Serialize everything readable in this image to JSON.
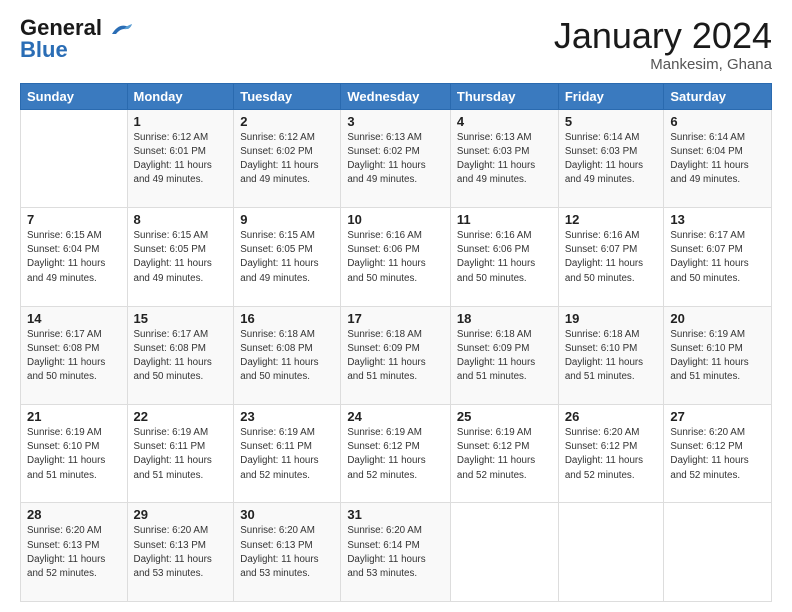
{
  "header": {
    "logo_line1": "General",
    "logo_line2": "Blue",
    "month": "January 2024",
    "location": "Mankesim, Ghana"
  },
  "days_of_week": [
    "Sunday",
    "Monday",
    "Tuesday",
    "Wednesday",
    "Thursday",
    "Friday",
    "Saturday"
  ],
  "weeks": [
    [
      {
        "num": "",
        "info": ""
      },
      {
        "num": "1",
        "info": "Sunrise: 6:12 AM\nSunset: 6:01 PM\nDaylight: 11 hours\nand 49 minutes."
      },
      {
        "num": "2",
        "info": "Sunrise: 6:12 AM\nSunset: 6:02 PM\nDaylight: 11 hours\nand 49 minutes."
      },
      {
        "num": "3",
        "info": "Sunrise: 6:13 AM\nSunset: 6:02 PM\nDaylight: 11 hours\nand 49 minutes."
      },
      {
        "num": "4",
        "info": "Sunrise: 6:13 AM\nSunset: 6:03 PM\nDaylight: 11 hours\nand 49 minutes."
      },
      {
        "num": "5",
        "info": "Sunrise: 6:14 AM\nSunset: 6:03 PM\nDaylight: 11 hours\nand 49 minutes."
      },
      {
        "num": "6",
        "info": "Sunrise: 6:14 AM\nSunset: 6:04 PM\nDaylight: 11 hours\nand 49 minutes."
      }
    ],
    [
      {
        "num": "7",
        "info": "Sunrise: 6:15 AM\nSunset: 6:04 PM\nDaylight: 11 hours\nand 49 minutes."
      },
      {
        "num": "8",
        "info": "Sunrise: 6:15 AM\nSunset: 6:05 PM\nDaylight: 11 hours\nand 49 minutes."
      },
      {
        "num": "9",
        "info": "Sunrise: 6:15 AM\nSunset: 6:05 PM\nDaylight: 11 hours\nand 49 minutes."
      },
      {
        "num": "10",
        "info": "Sunrise: 6:16 AM\nSunset: 6:06 PM\nDaylight: 11 hours\nand 50 minutes."
      },
      {
        "num": "11",
        "info": "Sunrise: 6:16 AM\nSunset: 6:06 PM\nDaylight: 11 hours\nand 50 minutes."
      },
      {
        "num": "12",
        "info": "Sunrise: 6:16 AM\nSunset: 6:07 PM\nDaylight: 11 hours\nand 50 minutes."
      },
      {
        "num": "13",
        "info": "Sunrise: 6:17 AM\nSunset: 6:07 PM\nDaylight: 11 hours\nand 50 minutes."
      }
    ],
    [
      {
        "num": "14",
        "info": "Sunrise: 6:17 AM\nSunset: 6:08 PM\nDaylight: 11 hours\nand 50 minutes."
      },
      {
        "num": "15",
        "info": "Sunrise: 6:17 AM\nSunset: 6:08 PM\nDaylight: 11 hours\nand 50 minutes."
      },
      {
        "num": "16",
        "info": "Sunrise: 6:18 AM\nSunset: 6:08 PM\nDaylight: 11 hours\nand 50 minutes."
      },
      {
        "num": "17",
        "info": "Sunrise: 6:18 AM\nSunset: 6:09 PM\nDaylight: 11 hours\nand 51 minutes."
      },
      {
        "num": "18",
        "info": "Sunrise: 6:18 AM\nSunset: 6:09 PM\nDaylight: 11 hours\nand 51 minutes."
      },
      {
        "num": "19",
        "info": "Sunrise: 6:18 AM\nSunset: 6:10 PM\nDaylight: 11 hours\nand 51 minutes."
      },
      {
        "num": "20",
        "info": "Sunrise: 6:19 AM\nSunset: 6:10 PM\nDaylight: 11 hours\nand 51 minutes."
      }
    ],
    [
      {
        "num": "21",
        "info": "Sunrise: 6:19 AM\nSunset: 6:10 PM\nDaylight: 11 hours\nand 51 minutes."
      },
      {
        "num": "22",
        "info": "Sunrise: 6:19 AM\nSunset: 6:11 PM\nDaylight: 11 hours\nand 51 minutes."
      },
      {
        "num": "23",
        "info": "Sunrise: 6:19 AM\nSunset: 6:11 PM\nDaylight: 11 hours\nand 52 minutes."
      },
      {
        "num": "24",
        "info": "Sunrise: 6:19 AM\nSunset: 6:12 PM\nDaylight: 11 hours\nand 52 minutes."
      },
      {
        "num": "25",
        "info": "Sunrise: 6:19 AM\nSunset: 6:12 PM\nDaylight: 11 hours\nand 52 minutes."
      },
      {
        "num": "26",
        "info": "Sunrise: 6:20 AM\nSunset: 6:12 PM\nDaylight: 11 hours\nand 52 minutes."
      },
      {
        "num": "27",
        "info": "Sunrise: 6:20 AM\nSunset: 6:12 PM\nDaylight: 11 hours\nand 52 minutes."
      }
    ],
    [
      {
        "num": "28",
        "info": "Sunrise: 6:20 AM\nSunset: 6:13 PM\nDaylight: 11 hours\nand 52 minutes."
      },
      {
        "num": "29",
        "info": "Sunrise: 6:20 AM\nSunset: 6:13 PM\nDaylight: 11 hours\nand 53 minutes."
      },
      {
        "num": "30",
        "info": "Sunrise: 6:20 AM\nSunset: 6:13 PM\nDaylight: 11 hours\nand 53 minutes."
      },
      {
        "num": "31",
        "info": "Sunrise: 6:20 AM\nSunset: 6:14 PM\nDaylight: 11 hours\nand 53 minutes."
      },
      {
        "num": "",
        "info": ""
      },
      {
        "num": "",
        "info": ""
      },
      {
        "num": "",
        "info": ""
      }
    ]
  ]
}
